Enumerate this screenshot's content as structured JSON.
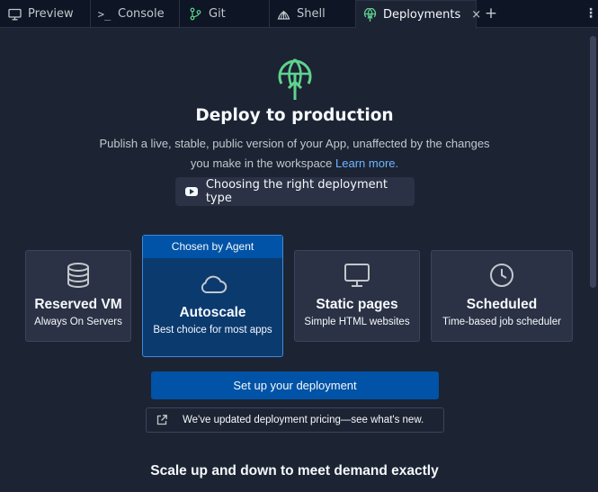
{
  "tabs": [
    {
      "label": "Preview",
      "icon": "monitor-icon"
    },
    {
      "label": "Console",
      "icon": "terminal-icon"
    },
    {
      "label": "Git",
      "icon": "git-branch-icon"
    },
    {
      "label": "Shell",
      "icon": "shell-icon"
    },
    {
      "label": "Deployments",
      "icon": "deploy-globe-icon",
      "active": true
    }
  ],
  "tab_close": "×",
  "tab_add": "+",
  "tab_more": "⋮",
  "hero": {
    "title": "Deploy to production",
    "description": "Publish a live, stable, public version of your App, unaffected by the changes you make in the workspace",
    "learn_more": "Learn more.",
    "video_button": "Choosing the right deployment type"
  },
  "deployment_types": [
    {
      "name": "Reserved VM",
      "description": "Always On Servers",
      "icon": "database-icon"
    },
    {
      "name": "Autoscale",
      "description": "Best choice for most apps",
      "icon": "cloud-icon",
      "badge": "Chosen by Agent",
      "selected": true
    },
    {
      "name": "Static pages",
      "description": "Simple HTML websites",
      "icon": "monitor-icon"
    },
    {
      "name": "Scheduled",
      "description": "Time-based job scheduler",
      "icon": "clock-icon"
    }
  ],
  "setup_button": "Set up your deployment",
  "pricing_notice": "We've updated deployment pricing—see what's new.",
  "subheading": "Scale up and down to meet demand exactly",
  "colors": {
    "background": "#1c2333",
    "tabbar": "#0e1525",
    "card": "#2b3245",
    "primary": "#0053a6",
    "selected_card": "#0b3a6f",
    "link": "#6eb6ff",
    "deploy_icon": "#5fd38d"
  }
}
